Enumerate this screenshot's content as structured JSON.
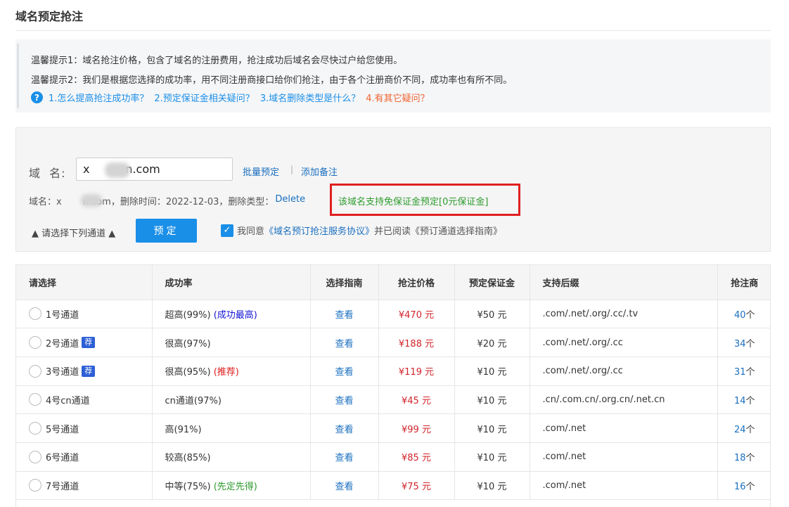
{
  "page_title": "域名预定抢注",
  "tips": {
    "tip1": "温馨提示1：域名抢注价格，包含了域名的注册费用，抢注成功后域名会尽快过户给您使用。",
    "tip2": "温馨提示2：我们是根据您选择的成功率，用不同注册商接口给你们抢注，由于各个注册商价不同，成功率也有所不同。",
    "faq_icon": "question-circle-icon",
    "faq": [
      "1.怎么提高抢注成功率？",
      "2.预定保证金相关疑问？",
      "3.域名删除类型是什么？",
      "4.有其它疑问？"
    ]
  },
  "form": {
    "domain_label": "域  名:",
    "domain_value": "x          n.com",
    "batch_link": "批量预定",
    "separator": "|",
    "note_link": "添加备注",
    "info_prefix": "域名：x",
    "info_rest": "n.com，删除时间：2022-12-03，删除类型：",
    "delete_type": "Delete",
    "free_note": "该域名支持免保证金预定[0元保证金]",
    "select_channel": "▲ 请选择下列通道 ▲",
    "book_button": "预定",
    "agree_prefix": "我同意",
    "agree_link": "《域名预订抢注服务协议》",
    "agree_suffix": "并已阅读《预订通道选择指南》"
  },
  "table": {
    "headers": [
      "请选择",
      "成功率",
      "选择指南",
      "抢注价格",
      "预定保证金",
      "支持后缀",
      "抢注商"
    ],
    "rows": [
      {
        "channel": "1号通道",
        "badge": "",
        "rate": "超高(99%)",
        "note": "(成功最高)",
        "note_color": "blue",
        "guide": "查看",
        "price": "¥470 元",
        "deposit": "¥50 元",
        "suffix": ".com/.net/.org/.cc/.tv",
        "count": "40",
        "unit": "个"
      },
      {
        "channel": "2号通道",
        "badge": "荐",
        "rate": "很高(97%)",
        "note": "",
        "note_color": "",
        "guide": "查看",
        "price": "¥188 元",
        "deposit": "¥20 元",
        "suffix": ".com/.net/.org/.cc",
        "count": "34",
        "unit": "个"
      },
      {
        "channel": "3号通道",
        "badge": "荐",
        "rate": "很高(95%)",
        "note": "(推荐)",
        "note_color": "red",
        "guide": "查看",
        "price": "¥119 元",
        "deposit": "¥10 元",
        "suffix": ".com/.net/.org/.cc",
        "count": "31",
        "unit": "个"
      },
      {
        "channel": "4号cn通道",
        "badge": "",
        "rate": "cn通道(97%)",
        "note": "",
        "note_color": "",
        "guide": "查看",
        "price": "¥45 元",
        "deposit": "¥10 元",
        "suffix": ".cn/.com.cn/.org.cn/.net.cn",
        "count": "14",
        "unit": "个"
      },
      {
        "channel": "5号通道",
        "badge": "",
        "rate": "高(91%)",
        "note": "",
        "note_color": "",
        "guide": "查看",
        "price": "¥99 元",
        "deposit": "¥10 元",
        "suffix": ".com/.net",
        "count": "24",
        "unit": "个"
      },
      {
        "channel": "6号通道",
        "badge": "",
        "rate": "较高(85%)",
        "note": "",
        "note_color": "",
        "guide": "查看",
        "price": "¥85 元",
        "deposit": "¥10 元",
        "suffix": ".com/.net",
        "count": "18",
        "unit": "个"
      },
      {
        "channel": "7号通道",
        "badge": "",
        "rate": "中等(75%)",
        "note": "(先定先得)",
        "note_color": "green",
        "guide": "查看",
        "price": "¥75 元",
        "deposit": "¥10 元",
        "suffix": ".com/.net",
        "count": "16",
        "unit": "个"
      }
    ]
  },
  "colors": {
    "accent": "#1a8fe8",
    "link": "#1a6fbf",
    "price": "#d0232a",
    "highlight_box": "#e02020",
    "free_note": "#2e9b2e"
  }
}
